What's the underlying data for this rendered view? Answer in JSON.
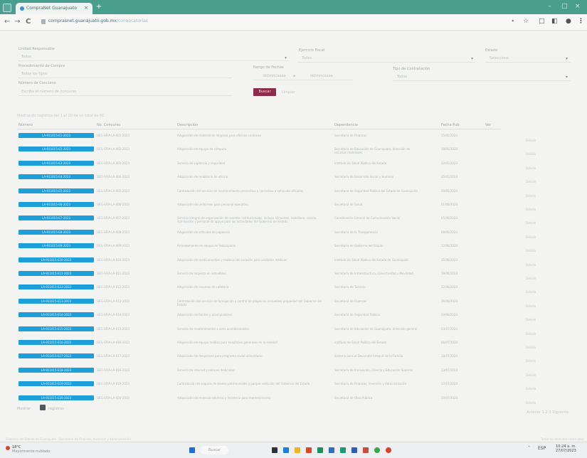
{
  "browser": {
    "tab_title": "CompraNet Guanajuato",
    "tab_close": "×",
    "new_tab": "+",
    "back": "←",
    "forward": "→",
    "reload": "C",
    "url_host": "comprasnet.guanajuato.gob.mx",
    "url_path": "/convocatorias",
    "window_controls": [
      "–",
      "□",
      "×"
    ],
    "toolbar_icons": [
      "⋆",
      "☆",
      "□",
      "◧",
      "●",
      "⋮"
    ]
  },
  "filters": {
    "unidad_label": "Unidad Responsable",
    "unidad_value": "Todos",
    "proc_label": "Procedimiento de Compra",
    "proc_value": "Todos los tipos",
    "numero_label": "Número de Concurso",
    "numero_placeholder": "Escriba el número de concurso",
    "dependencia_label": "Ejercicio Fiscal",
    "dependencia_value": "Todos",
    "rango_label": "Rango de Fechas",
    "fecha_ini": "dd/mm/aaaa",
    "fecha_sep": "a",
    "fecha_fin": "dd/mm/aaaa",
    "estado_label": "Estado",
    "estado_value": "Seleccione",
    "tipo_label": "Tipo de Contratación",
    "tipo_value": "Todos",
    "buscar": "Buscar",
    "limpiar": "Limpiar"
  },
  "summary": "Mostrando registros del 1 al 20 de un total de 60",
  "table": {
    "headers": [
      "Número",
      "No. Concurso",
      "Descripción",
      "Dependencia",
      "Fecha Pub.",
      "Ver"
    ],
    "rows": [
      {
        "num": "LA-911015-E1-2023",
        "concurso": "GEG-SFIA-LA-001-2023",
        "desc": "Adquisición de material de limpieza para oficinas centrales",
        "dep": "Secretaría de Finanzas",
        "fecha": "15/05/2023",
        "det": "Detalle"
      },
      {
        "num": "LA-911015-E2-2023",
        "concurso": "GEG-SFIA-LA-002-2023",
        "desc": "Adquisición de equipo de cómputo",
        "dep": "Secretaría de Educación de Guanajuato, dirección de recursos materiales",
        "fecha": "18/05/2023",
        "det": "Detalle"
      },
      {
        "num": "LA-911015-E3-2023",
        "concurso": "GEG-SFIA-LA-003-2023",
        "desc": "Servicio de vigilancia y seguridad",
        "dep": "Instituto de Salud Pública del Estado",
        "fecha": "22/05/2023",
        "det": "Detalle"
      },
      {
        "num": "LA-911015-E4-2023",
        "concurso": "GEG-SFIA-LA-004-2023",
        "desc": "Adquisición de mobiliario de oficina",
        "dep": "Secretaría de Desarrollo Social y Humano",
        "fecha": "25/05/2023",
        "det": "Detalle"
      },
      {
        "num": "LA-911015-E5-2023",
        "concurso": "GEG-SFIA-LA-005-2023",
        "desc": "Contratación del servicio de mantenimiento preventivo y correctivo a vehículos oficiales",
        "dep": "Secretaría de Seguridad Pública del Estado de Guanajuato",
        "fecha": "29/05/2023",
        "det": "Detalle"
      },
      {
        "num": "LA-911015-E6-2023",
        "concurso": "GEG-SFIA-LA-006-2023",
        "desc": "Adquisición de uniformes para personal operativo",
        "dep": "Secretaría de Salud",
        "fecha": "01/06/2023",
        "det": "Detalle"
      },
      {
        "num": "LA-911015-E7-2023",
        "concurso": "GEG-SFIA-LA-007-2023",
        "desc": "Servicio integral de organización de eventos institucionales, incluye alimentos, mobiliario, sonido, iluminación y personal de apoyo para las actividades del Gobierno del Estado",
        "dep": "Coordinación General de Comunicación Social",
        "fecha": "05/06/2023",
        "det": "Detalle"
      },
      {
        "num": "LA-911015-E8-2023",
        "concurso": "GEG-SFIA-LA-008-2023",
        "desc": "Adquisición de artículos de papelería",
        "dep": "Secretaría de la Transparencia",
        "fecha": "08/06/2023",
        "det": "Detalle"
      },
      {
        "num": "LA-911015-E9-2023",
        "concurso": "GEG-SFIA-LA-009-2023",
        "desc": "Arrendamiento de equipo de fotocopiado",
        "dep": "Secretaría de Gobierno del Estado",
        "fecha": "12/06/2023",
        "det": "Detalle"
      },
      {
        "num": "LA-911015-E10-2023",
        "concurso": "GEG-SFIA-LA-010-2023",
        "desc": "Adquisición de medicamentos y material de curación para unidades médicas",
        "dep": "Instituto de Salud Pública del Estado de Guanajuato",
        "fecha": "15/06/2023",
        "det": "Detalle"
      },
      {
        "num": "LA-911015-E11-2023",
        "concurso": "GEG-SFIA-LA-011-2023",
        "desc": "Servicio de limpieza en inmuebles",
        "dep": "Secretaría de Infraestructura, Conectividad y Movilidad",
        "fecha": "19/06/2023",
        "det": "Detalle"
      },
      {
        "num": "LA-911015-E12-2023",
        "concurso": "GEG-SFIA-LA-012-2023",
        "desc": "Adquisición de insumos de cafetería",
        "dep": "Secretaría de Turismo",
        "fecha": "22/06/2023",
        "det": "Detalle"
      },
      {
        "num": "LA-911015-E13-2023",
        "concurso": "GEG-SFIA-LA-013-2023",
        "desc": "Contratación del servicio de fumigación y control de plagas en inmuebles propiedad del Gobierno del Estado",
        "dep": "Secretaría de Finanzas",
        "fecha": "26/06/2023",
        "det": "Detalle"
      },
      {
        "num": "LA-911015-E14-2023",
        "concurso": "GEG-SFIA-LA-014-2023",
        "desc": "Adquisición de llantas y acumuladores",
        "dep": "Secretaría de Seguridad Pública",
        "fecha": "29/06/2023",
        "det": "Detalle"
      },
      {
        "num": "LA-911015-E15-2023",
        "concurso": "GEG-SFIA-LA-015-2023",
        "desc": "Servicio de mantenimiento a aires acondicionados",
        "dep": "Secretaría de Educación de Guanajuato, dirección general",
        "fecha": "03/07/2023",
        "det": "Detalle"
      },
      {
        "num": "LA-911015-E16-2023",
        "concurso": "GEG-SFIA-LA-016-2023",
        "desc": "Adquisición de equipo médico para hospitales generales de la entidad",
        "dep": "Instituto de Salud Pública del Estado",
        "fecha": "06/07/2023",
        "det": "Detalle"
      },
      {
        "num": "LA-911015-E17-2023",
        "concurso": "GEG-SFIA-LA-017-2023",
        "desc": "Adquisición de despensas para programa social alimentario",
        "dep": "Sistema para el Desarrollo Integral de la Familia",
        "fecha": "10/07/2023",
        "det": "Detalle"
      },
      {
        "num": "LA-911015-E18-2023",
        "concurso": "GEG-SFIA-LA-018-2023",
        "desc": "Servicio de internet y enlaces dedicados",
        "dep": "Secretaría de Innovación, Ciencia y Educación Superior",
        "fecha": "13/07/2023",
        "det": "Detalle"
      },
      {
        "num": "LA-911015-E19-2023",
        "concurso": "GEG-SFIA-LA-019-2023",
        "desc": "Contratación de seguros de bienes patrimoniales y parque vehicular del Gobierno del Estado",
        "dep": "Secretaría de Finanzas, Inversión y Administración",
        "fecha": "17/07/2023",
        "det": "Detalle"
      },
      {
        "num": "LA-911015-E20-2023",
        "concurso": "GEG-SFIA-LA-020-2023",
        "desc": "Adquisición de material eléctrico y ferretería para mantenimiento",
        "dep": "Secretaría de Obra Pública",
        "fecha": "20/07/2023",
        "det": "Detalle"
      }
    ]
  },
  "pager": {
    "left": "Mostrar",
    "left2": "registros",
    "right": "Anterior 1 2 3 Siguiente"
  },
  "footer": {
    "left": "Gobierno del Estado de Guanajuato · Secretaría de Finanzas, Inversión y Administración",
    "right": "Todos los derechos reservados"
  },
  "taskbar": {
    "weather_temp": "18°C",
    "weather_desc": "Mayormente nublado",
    "search": "Buscar",
    "time": "10:24 a. m.",
    "date": "27/07/2023",
    "lang": "ESP"
  }
}
